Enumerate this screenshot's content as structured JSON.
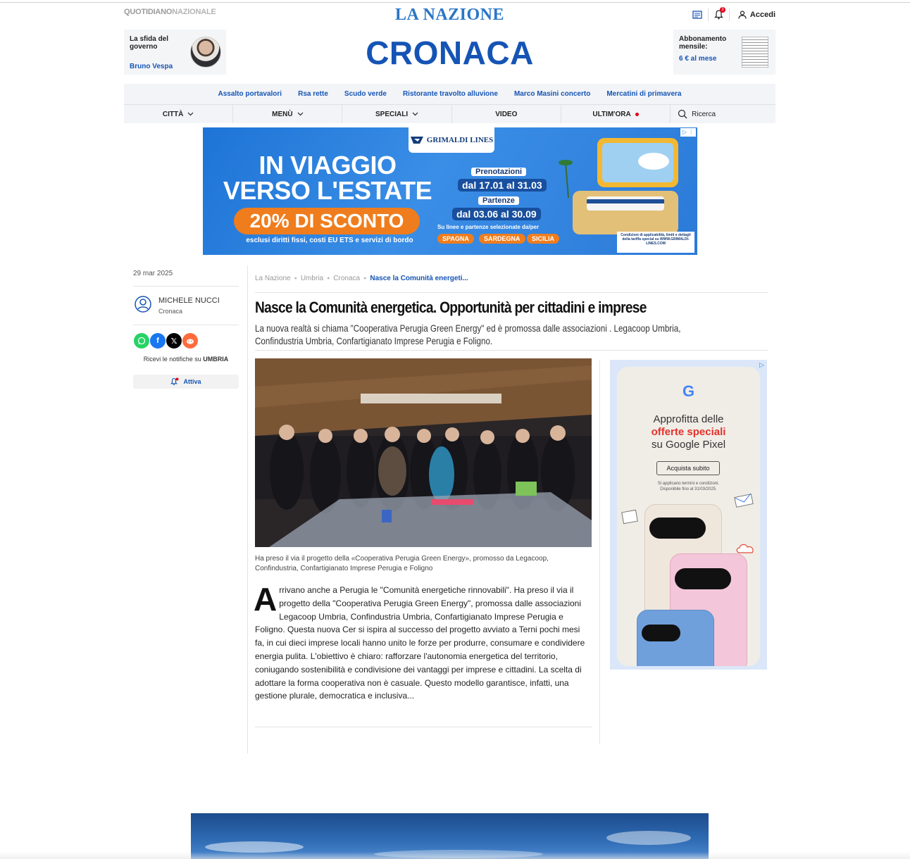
{
  "header": {
    "network_a": "QUOTIDIANO",
    "network_b": "NAZIONALE",
    "brand": "LA NAZIONE",
    "section": "CRONACA",
    "login": "Accedi",
    "notif_count": "3",
    "promo_left": {
      "title": "La sfida del governo",
      "author": "Bruno Vespa"
    },
    "promo_right": {
      "title": "Abbonamento mensile:",
      "price": "6 € al mese"
    }
  },
  "trending": [
    "Assalto portavalori",
    "Rsa rette",
    "Scudo verde",
    "Ristorante travolto alluvione",
    "Marco Masini concerto",
    "Mercatini di primavera"
  ],
  "menu": {
    "citta": "CITTÀ",
    "menu": "MENÙ",
    "speciali": "SPECIALI",
    "video": "VIDEO",
    "ultimora": "ULTIM'ORA",
    "search": "Ricerca"
  },
  "banner": {
    "logo": "GRIMALDI LINES",
    "headline1": "IN VIAGGIO",
    "headline2": "VERSO L'ESTATE",
    "discount": "20% DI SCONTO",
    "sub": "esclusi diritti fissi, costi EU ETS e servizi di bordo",
    "label1": "Prenotazioni",
    "date1": "dal 17.01 al 31.03",
    "label2": "Partenze",
    "date2": "dal 03.06 al 30.09",
    "small": "Su linee e partenze selezionate da/per",
    "tags": [
      "SPAGNA",
      "SARDEGNA",
      "SICILIA"
    ],
    "conditions": "Condizioni di applicabilità, limiti e dettagli della tariffa special su WWW.GRIMALDI-LINES.COM"
  },
  "article": {
    "date": "29 mar 2025",
    "author_name": "MICHELE NUCCI",
    "author_section": "Cronaca",
    "notify_text": "Ricevi le notifiche su",
    "notify_region": "UMBRIA",
    "notify_btn": "Attiva",
    "breadcrumb": [
      "La Nazione",
      "Umbria",
      "Cronaca",
      "Nasce la Comunità energeti..."
    ],
    "title": "Nasce la Comunità energetica. Opportunità per cittadini e imprese",
    "subtitle": "La nuova realtà si chiama \"Cooperativa Perugia Green Energy\" ed è promossa dalle associazioni . Legacoop Umbria, Confindustria Umbria, Confartigianato Imprese Perugia e Foligno.",
    "caption": "Ha preso il via il progetto della «Cooperativa Perugia Green Energy», promosso da Legacoop, Confindustria, Confartigianato Imprese Perugia e Foligno",
    "dropcap": "A",
    "body": "rrivano anche a Perugia le \"Comunità energetiche rinnovabili\". Ha preso il via il progetto della \"Cooperativa Perugia Green Energy\", promossa dalle associazioni Legacoop Umbria, Confindustria Umbria, Confartigianato Imprese Perugia e Foligno. Questa nuova Cer si ispira al successo del progetto avviato a Terni pochi mesi fa, in cui dieci imprese locali hanno unito le forze per produrre, consumare e condividere energia pulita. L'obiettivo è chiaro: rafforzare l'autonomia energetica del territorio, coniugando sostenibilità e condivisione dei vantaggi per imprese e cittadini. La scelta di adottare la forma cooperativa non è casuale. Questo modello garantisce, infatti, una gestione plurale, democratica e inclusiva..."
  },
  "side_ad": {
    "logo": "G",
    "line1": "Approfitta delle",
    "line2": "offerte speciali",
    "line3": "su Google Pixel",
    "button": "Acquista subito",
    "fine1": "Si applicano termini e condizioni.",
    "fine2": "Disponibile fino al 31/03/2025."
  },
  "colors": {
    "brand_blue": "#1554b5",
    "accent_red": "#e2001a",
    "banner_orange": "#f07d1d"
  }
}
